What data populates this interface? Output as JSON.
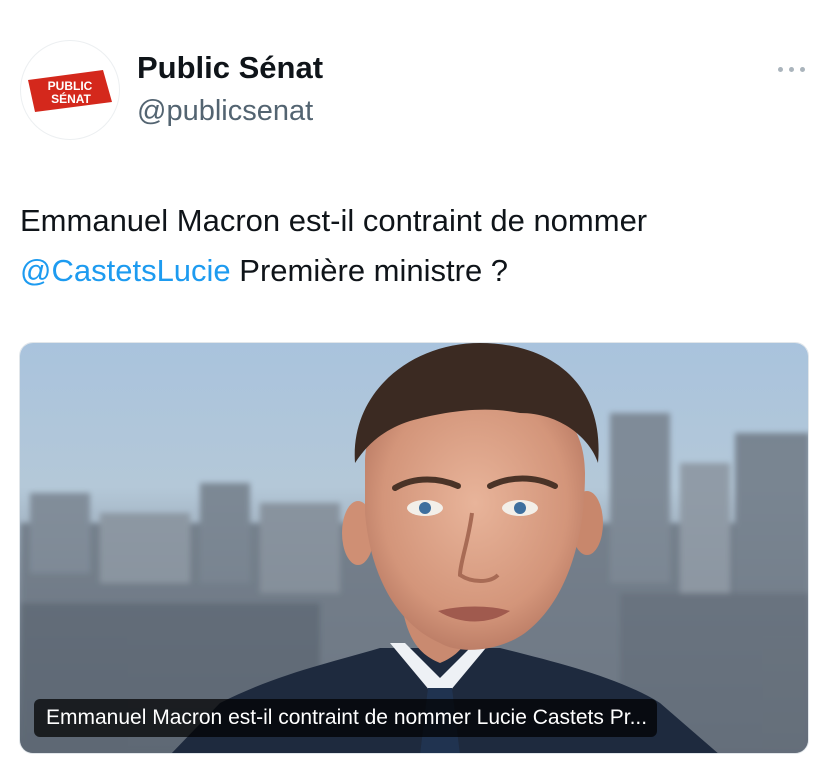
{
  "account": {
    "display_name": "Public Sénat",
    "handle": "@publicsenat",
    "avatar_logo_line1": "PUBLIC",
    "avatar_logo_line2": "SÉNAT"
  },
  "menu": {
    "icon": "more-horizontal-icon"
  },
  "tweet": {
    "text_before": "Emmanuel Macron est-il contraint de nommer ",
    "mention": "@CastetsLucie",
    "text_after": " Première ministre ?"
  },
  "card": {
    "caption": "Emmanuel Macron est-il contraint de nommer Lucie Castets Pr..."
  },
  "colors": {
    "mention": "#1d9bf0",
    "logo_red": "#d4281c",
    "handle_gray": "#536471"
  }
}
